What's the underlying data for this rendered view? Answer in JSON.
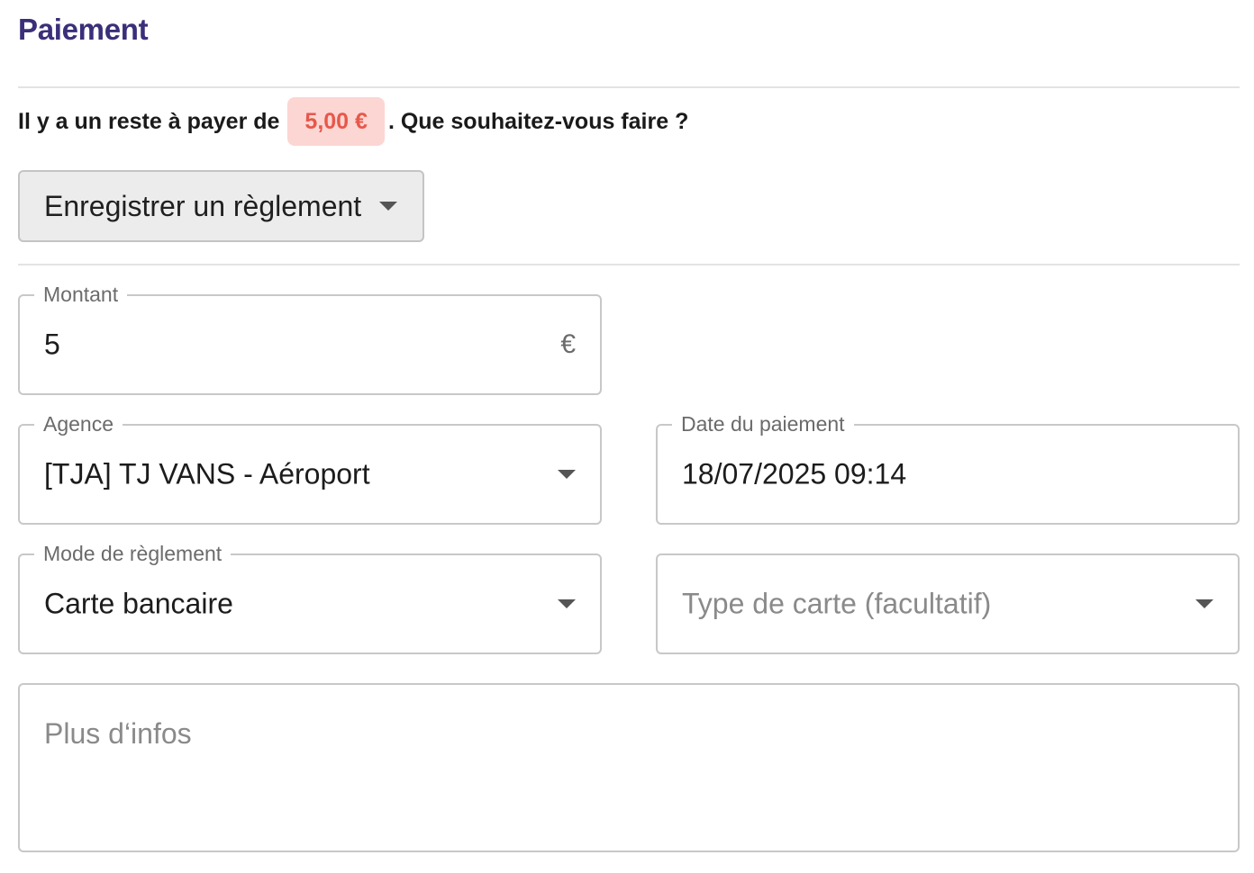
{
  "page": {
    "title": "Paiement"
  },
  "remaining": {
    "text_before": "Il y a un reste à payer de",
    "amount": "5,00 €",
    "text_after": ". Que souhaitez-vous faire ?"
  },
  "action_dropdown": {
    "label": "Enregistrer un règlement",
    "icon": "chevron-down-icon"
  },
  "form": {
    "montant": {
      "label": "Montant",
      "value": "5",
      "suffix": "€"
    },
    "agence": {
      "label": "Agence",
      "value": "[TJA] TJ VANS - Aéroport"
    },
    "date_paiement": {
      "label": "Date du paiement",
      "value": "18/07/2025 09:14"
    },
    "mode_reglement": {
      "label": "Mode de règlement",
      "value": "Carte bancaire"
    },
    "type_carte": {
      "placeholder": "Type de carte (facultatif)"
    },
    "plus_infos": {
      "placeholder": "Plus d‘infos"
    }
  },
  "colors": {
    "title": "#3a2f7a",
    "badge_bg": "#fcd6d3",
    "badge_text": "#e6584b",
    "border": "#c8c8c8"
  }
}
